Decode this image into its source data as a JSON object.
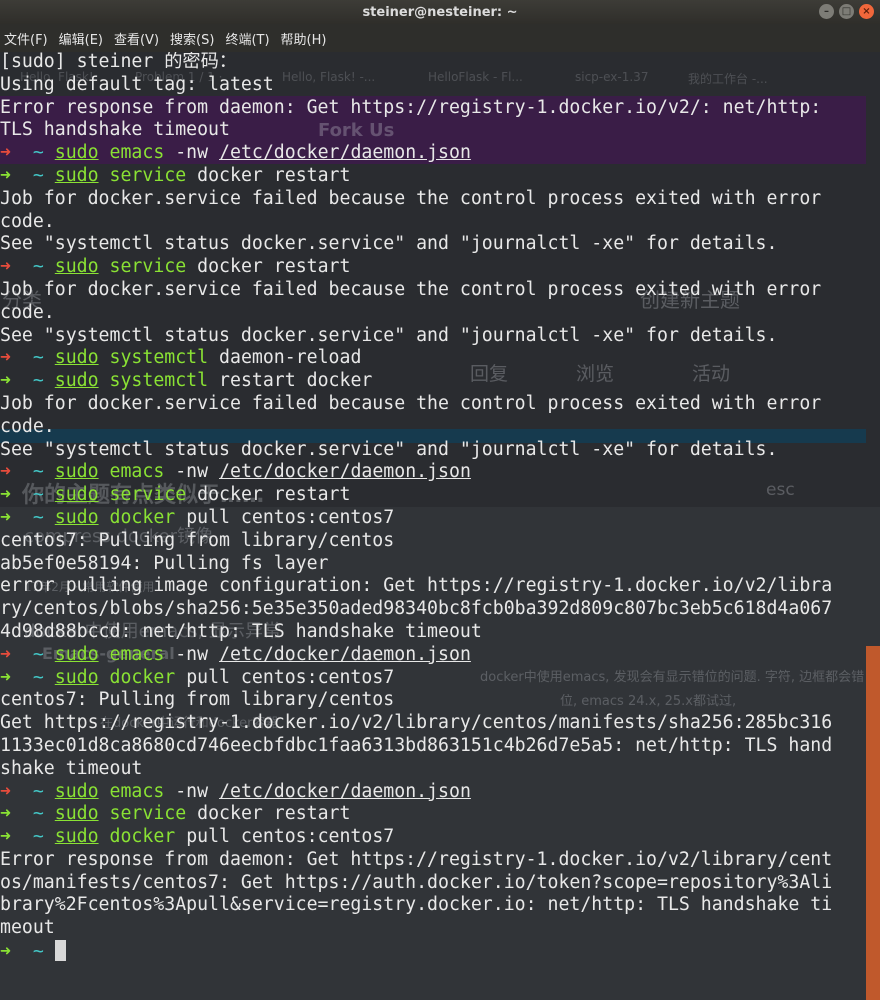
{
  "window": {
    "title": "steiner@nesteiner: ~"
  },
  "menu": [
    "文件(F)",
    "编辑(E)",
    "查看(V)",
    "搜索(S)",
    "终端(T)",
    "帮助(H)"
  ],
  "ghost_texts": {
    "tab1": "Hello, Flask!",
    "tab2": "Problem 1 / 1 ·",
    "tab3": "Hello, Flask! -...",
    "tab4": "HelloFlask - Fl...",
    "tab5": "sicp-ex-1.37",
    "tab6": "我的工作台 -...",
    "fork": "Fork Us",
    "new_topic": "创建新主题",
    "category": "分类",
    "reply": "回复",
    "browse": "浏览",
    "activity": "活动",
    "similar": "你的主题有点类似于……",
    "esc": "esc",
    "compress": "compress docker镜像",
    "item2": "docker中使用emacs, 显示异常",
    "meta": "17年2月 · 常用软件使用",
    "tag": "Emacs-general",
    "desc1": "docker中使用emacs, 发现会有显示错位的问题. 字符, 边框都会错",
    "desc2": "位, emacs 24.x, 25.x都试过,",
    "desc3": "在docker中运行和docker容器"
  },
  "terminal": {
    "lines": [
      {
        "type": "plain",
        "text": "[sudo] steiner 的密码："
      },
      {
        "type": "plain",
        "text": "Using default tag: latest"
      },
      {
        "type": "plain",
        "text": "Error response from daemon: Get https://registry-1.docker.io/v2/: net/http:"
      },
      {
        "type": "plain",
        "text": "TLS handshake timeout"
      },
      {
        "type": "prompt",
        "status": "error",
        "sudo": "sudo",
        "tool": "emacs",
        "args": "-nw",
        "path": "/etc/docker/daemon.json"
      },
      {
        "type": "prompt",
        "status": "ok",
        "sudo": "sudo",
        "tool": "service",
        "args": "docker restart",
        "path": ""
      },
      {
        "type": "plain",
        "text": "Job for docker.service failed because the control process exited with error"
      },
      {
        "type": "plain",
        "text": "code."
      },
      {
        "type": "plain",
        "text": "See \"systemctl status docker.service\" and \"journalctl -xe\" for details."
      },
      {
        "type": "prompt",
        "status": "error",
        "sudo": "sudo",
        "tool": "service",
        "args": "docker restart",
        "path": ""
      },
      {
        "type": "plain",
        "text": "Job for docker.service failed because the control process exited with error"
      },
      {
        "type": "plain",
        "text": "code."
      },
      {
        "type": "plain",
        "text": "See \"systemctl status docker.service\" and \"journalctl -xe\" for details."
      },
      {
        "type": "prompt",
        "status": "error",
        "sudo": "sudo",
        "tool": "systemctl",
        "args": "daemon-reload",
        "path": ""
      },
      {
        "type": "prompt",
        "status": "ok",
        "sudo": "sudo",
        "tool": "systemctl",
        "args": "restart docker",
        "path": ""
      },
      {
        "type": "plain",
        "text": "Job for docker.service failed because the control process exited with error"
      },
      {
        "type": "plain",
        "text": "code."
      },
      {
        "type": "plain",
        "text": "See \"systemctl status docker.service\" and \"journalctl -xe\" for details."
      },
      {
        "type": "prompt",
        "status": "error",
        "sudo": "sudo",
        "tool": "emacs",
        "args": "-nw",
        "path": "/etc/docker/daemon.json"
      },
      {
        "type": "prompt",
        "status": "ok",
        "sudo": "sudo",
        "tool": "service",
        "args": "docker restart",
        "path": ""
      },
      {
        "type": "prompt",
        "status": "ok",
        "sudo": "sudo",
        "tool": "docker",
        "args": "pull centos:centos7",
        "path": ""
      },
      {
        "type": "plain",
        "text": "centos7: Pulling from library/centos"
      },
      {
        "type": "plain",
        "text": "ab5ef0e58194: Pulling fs layer"
      },
      {
        "type": "plain",
        "text": "error pulling image configuration: Get https://registry-1.docker.io/v2/libra"
      },
      {
        "type": "plain",
        "text": "ry/centos/blobs/sha256:5e35e350aded98340bc8fcb0ba392d809c807bc3eb5c618d4a067"
      },
      {
        "type": "plain",
        "text": "4d98d88bccd: net/http: TLS handshake timeout"
      },
      {
        "type": "prompt",
        "status": "error",
        "sudo": "sudo",
        "tool": "emacs",
        "args": "-nw",
        "path": "/etc/docker/daemon.json"
      },
      {
        "type": "prompt",
        "status": "ok",
        "sudo": "sudo",
        "tool": "docker",
        "args": "pull centos:centos7",
        "path": ""
      },
      {
        "type": "plain",
        "text": "centos7: Pulling from library/centos"
      },
      {
        "type": "plain",
        "text": "Get https://registry-1.docker.io/v2/library/centos/manifests/sha256:285bc316"
      },
      {
        "type": "plain",
        "text": "1133ec01d8ca8680cd746eecbfdbc1faa6313bd863151c4b26d7e5a5: net/http: TLS hand"
      },
      {
        "type": "plain",
        "text": "shake timeout"
      },
      {
        "type": "prompt",
        "status": "error",
        "sudo": "sudo",
        "tool": "emacs",
        "args": "-nw",
        "path": "/etc/docker/daemon.json"
      },
      {
        "type": "prompt",
        "status": "ok",
        "sudo": "sudo",
        "tool": "service",
        "args": "docker restart",
        "path": ""
      },
      {
        "type": "prompt",
        "status": "ok",
        "sudo": "sudo",
        "tool": "docker",
        "args": "pull centos:centos7",
        "path": ""
      },
      {
        "type": "plain",
        "text": "Error response from daemon: Get https://registry-1.docker.io/v2/library/cent"
      },
      {
        "type": "plain",
        "text": "os/manifests/centos7: Get https://auth.docker.io/token?scope=repository%3Ali"
      },
      {
        "type": "plain",
        "text": "brary%2Fcentos%3Apull&service=registry.docker.io: net/http: TLS handshake ti"
      },
      {
        "type": "plain",
        "text": "meout"
      },
      {
        "type": "cursor",
        "status": "ok"
      }
    ]
  },
  "prompt": {
    "arrow": "➜",
    "cwd": "~"
  },
  "colors": {
    "error_arrow": "#e74c3c",
    "ok_arrow": "#8ae234",
    "cwd": "#43c8c8",
    "command": "#8ae234"
  }
}
